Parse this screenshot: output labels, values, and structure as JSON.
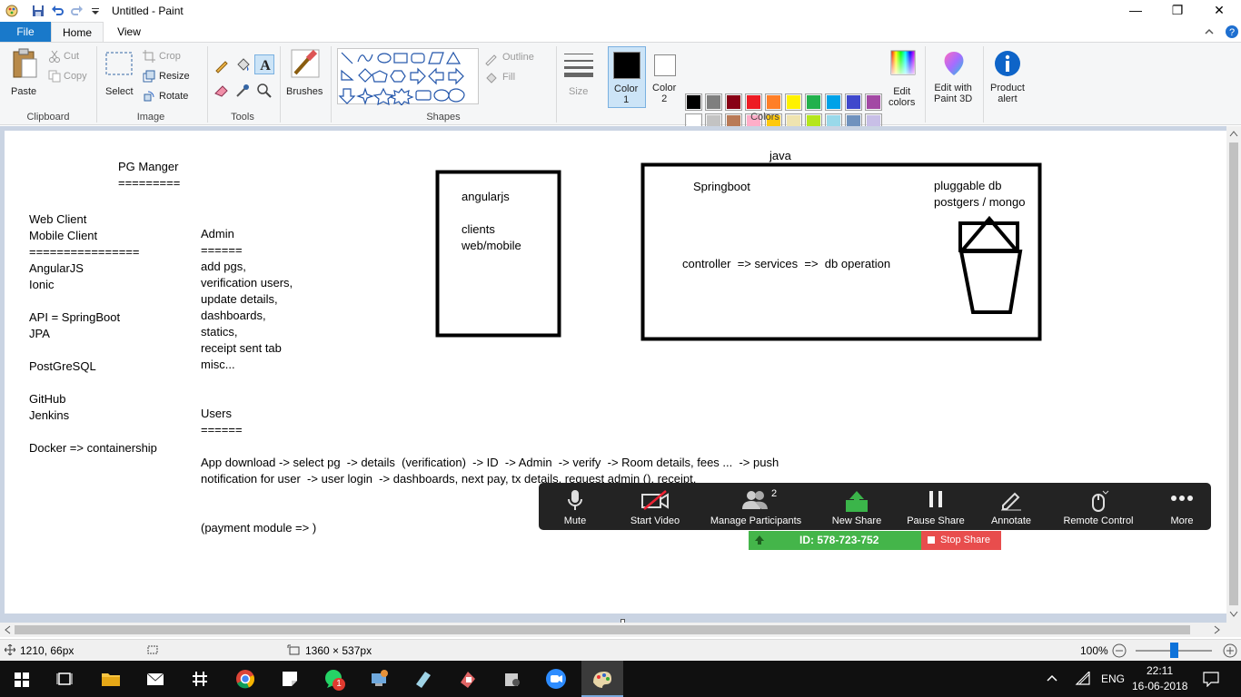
{
  "window": {
    "title": "Untitled - Paint",
    "controls": {
      "minimize": "—",
      "restore": "❐",
      "close": "✕"
    }
  },
  "tabs": [
    {
      "label": "File"
    },
    {
      "label": "Home"
    },
    {
      "label": "View"
    }
  ],
  "ribbon": {
    "clipboard": {
      "paste": "Paste",
      "cut": "Cut",
      "copy": "Copy",
      "group": "Clipboard"
    },
    "image": {
      "select": "Select",
      "crop": "Crop",
      "resize": "Resize",
      "rotate": "Rotate",
      "group": "Image"
    },
    "tools": {
      "group": "Tools"
    },
    "brushes": {
      "label": "Brushes"
    },
    "shapes": {
      "outline": "Outline",
      "fill": "Fill",
      "group": "Shapes"
    },
    "size": {
      "label": "Size"
    },
    "colors": {
      "color1": "Color\n1",
      "color2": "Color\n2",
      "edit_colors": "Edit\ncolors",
      "group": "Colors",
      "color1_value": "#000000",
      "color2_value": "#ffffff",
      "palette_row1": [
        "#000000",
        "#7f7f7f",
        "#880015",
        "#ed1c24",
        "#ff7f27",
        "#fff200",
        "#22b14c",
        "#00a2e8",
        "#3f48cc",
        "#a349a4"
      ],
      "palette_row2": [
        "#ffffff",
        "#c3c3c3",
        "#b97a57",
        "#ffaec9",
        "#ffc90e",
        "#efe4b0",
        "#b5e61d",
        "#99d9ea",
        "#7092be",
        "#c8bfe7"
      ],
      "palette_row3": [
        "#ffffff",
        "#ffffff",
        "#ffffff",
        "#ffffff",
        "#ffffff",
        "#ffffff",
        "#ffffff",
        "#ffffff",
        "#ffffff",
        "#ffffff"
      ]
    },
    "paint3d": {
      "label": "Edit with\nPaint 3D"
    },
    "product_alert": {
      "label": "Product\nalert"
    }
  },
  "canvas_text": {
    "title": "PG Manger",
    "title_underline": "=========",
    "stack": "Web Client\nMobile Client\n================\nAngularJS\nIonic\n\nAPI = SpringBoot\nJPA\n\nPostGreSQL\n\nGitHub\nJenkins\n\nDocker => containership",
    "admin": "Admin\n======\nadd pgs,\nverification users,\nupdate details,\ndashboards,\nstatics,\nreceipt sent tab\nmisc...",
    "users": "Users\n======",
    "flow": "App download -> select pg  -> details  (verification)  -> ID  -> Admin  -> verify  -> Room details, fees ...  -> push\nnotification for user  -> user login  -> dashboards, next pay, tx details, request admin (), receipt,",
    "payment": "(payment module => )",
    "angular_box": "angularjs\n\nclients\nweb/mobile",
    "java_label": "java",
    "springboot": "Springboot",
    "pluggable": "pluggable db\npostgers / mongo",
    "controller": "controller  => services  =>  db operation"
  },
  "zoom": {
    "buttons": [
      {
        "label": "Mute",
        "icon": "microphone-icon"
      },
      {
        "label": "Start Video",
        "icon": "video-off-icon"
      },
      {
        "label": "Manage Participants",
        "icon": "participants-icon",
        "count": "2"
      },
      {
        "label": "New Share",
        "icon": "share-icon"
      },
      {
        "label": "Pause Share",
        "icon": "pause-icon"
      },
      {
        "label": "Annotate",
        "icon": "pen-icon"
      },
      {
        "label": "Remote Control",
        "icon": "mouse-icon"
      },
      {
        "label": "More",
        "icon": "more-icon"
      }
    ],
    "meeting_id": "ID: 578-723-752",
    "stop_share": "Stop Share"
  },
  "status": {
    "cursor_pos": "1210, 66px",
    "canvas_size": "1360 × 537px",
    "zoom": "100%"
  },
  "taskbar": {
    "lang": "ENG",
    "time": "22:11",
    "date": "16-06-2018",
    "whatsapp_badge": "1"
  }
}
